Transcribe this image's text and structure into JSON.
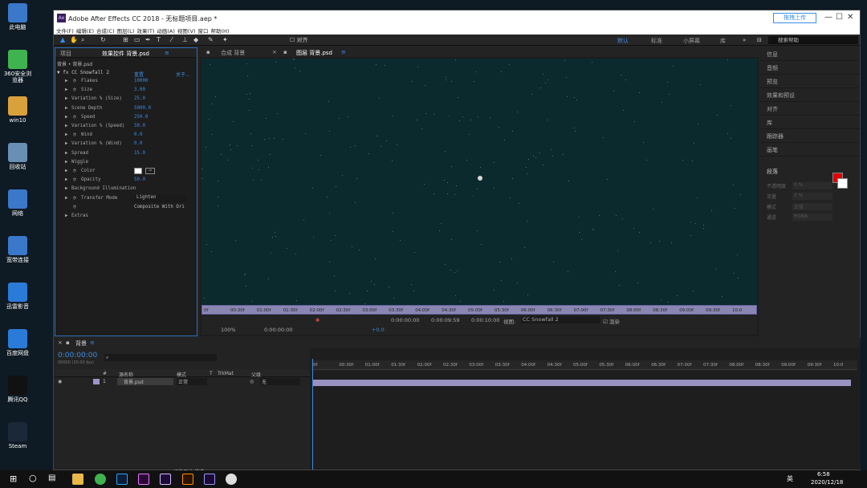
{
  "desktop": {
    "icons": [
      {
        "label": "此电脑",
        "color": "#3a78c9"
      },
      {
        "label": "360安全浏览器",
        "color": "#3fb34f"
      },
      {
        "label": "win10",
        "color": "#d9a13b"
      },
      {
        "label": "回收站",
        "color": "#6a8fb5"
      },
      {
        "label": "网络",
        "color": "#3a78c9"
      },
      {
        "label": "宽带连接",
        "color": "#3a78c9"
      },
      {
        "label": "迅雷影音",
        "color": "#2a7bd8"
      },
      {
        "label": "百度网盘",
        "color": "#2a7bd8"
      },
      {
        "label": "腾讯QQ",
        "color": "#111111"
      },
      {
        "label": "Steam",
        "color": "#1b2838"
      }
    ]
  },
  "window": {
    "title": "Adobe After Effects CC 2018 - 无标题项目.aep *",
    "app_badge": "Ae",
    "cloud_button": "拖拽上传",
    "minimize": "—",
    "maximize": "☐",
    "close": "✕"
  },
  "menu": [
    "文件(F)",
    "编辑(E)",
    "合成(C)",
    "图层(L)",
    "效果(T)",
    "动画(A)",
    "视图(V)",
    "窗口",
    "帮助(H)"
  ],
  "toolbar": {
    "align_label": "对齐",
    "workspaces": [
      "默认",
      "标准",
      "小屏幕",
      "库"
    ],
    "help_placeholder": "搜索帮助"
  },
  "fx_panel": {
    "tab_project": "项目",
    "tab_effects": "效果控件 背景.psd",
    "layer_path": "背景 • 背景.psd",
    "effect_name": "CC Snowfall 2",
    "reset": "重置",
    "about": "关于...",
    "params": [
      {
        "label": "Flakes",
        "value": "10000",
        "indent": 1,
        "stopwatch": true
      },
      {
        "label": "Size",
        "value": "3.00",
        "indent": 1,
        "stopwatch": true
      },
      {
        "label": "Variation % (Size)",
        "value": "25.0",
        "indent": 0
      },
      {
        "label": "Scene Depth",
        "value": "5000.0",
        "indent": 0
      },
      {
        "label": "Speed",
        "value": "250.0",
        "indent": 1,
        "stopwatch": true
      },
      {
        "label": "Variation % (Speed)",
        "value": "50.0",
        "indent": 0
      },
      {
        "label": "Wind",
        "value": "0.0",
        "indent": 1,
        "stopwatch": true
      },
      {
        "label": "Variation % (Wind)",
        "value": "0.0",
        "indent": 0
      },
      {
        "label": "Spread",
        "value": "15.0",
        "indent": 0
      },
      {
        "label": "Wiggle",
        "value": "",
        "indent": 0
      },
      {
        "label": "Color",
        "value": "",
        "indent": 1,
        "stopwatch": true
      },
      {
        "label": "Opacity",
        "value": "50.0",
        "indent": 1,
        "stopwatch": true
      },
      {
        "label": "Background Illumination",
        "value": "",
        "indent": 0
      },
      {
        "label": "Transfer Mode",
        "value": "Lighten",
        "indent": 1,
        "stopwatch": true
      },
      {
        "label": "",
        "value": "Composite With Ori",
        "indent": 1,
        "stopwatch": true
      },
      {
        "label": "Extras",
        "value": "",
        "indent": 0
      }
    ]
  },
  "comp": {
    "tab_comp": "合成 背景",
    "tab_layer": "图层 背景.psd",
    "ruler": [
      "0f",
      "00:30f",
      "01:00f",
      "01:30f",
      "02:00f",
      "02:30f",
      "03:00f",
      "03:30f",
      "04:00f",
      "04:30f",
      "05:00f",
      "05:30f",
      "06:00f",
      "06:30f",
      "07:00f",
      "07:30f",
      "08:00f",
      "08:30f",
      "09:00f",
      "09:30f",
      "10:0"
    ],
    "time_current": "0:00:00:00",
    "time_dur": "0:00:09:59",
    "time_end": "0:00:10:00",
    "view_label": "视图:",
    "view_value": "CC Snowfall 2",
    "render_label": "渲染",
    "zoom": "100%",
    "time_bottom": "0:00:00:00",
    "offset": "+0.0"
  },
  "right_panel": {
    "items": [
      "信息",
      "音频",
      "预览",
      "效果和预设",
      "对齐",
      "库",
      "跟踪器",
      "画笔"
    ],
    "paragraph": "段落",
    "props": [
      {
        "label": "不透明度",
        "value": "0 %"
      },
      {
        "label": "流量",
        "value": "0 %"
      },
      {
        "label": "模式",
        "value": "正常"
      },
      {
        "label": "通道",
        "value": "RGBA"
      }
    ],
    "fg_color": "#e00000",
    "bg_color": "#ffffff"
  },
  "timeline": {
    "tab": "背景",
    "timecode": "0:00:00:00",
    "timecode_sub": "00000 (30.00 fps)",
    "headers": {
      "num": "#",
      "name": "源名称",
      "mode": "模式",
      "t": "T",
      "trkmat": "TrkMat",
      "parent": "父级"
    },
    "layer": {
      "num": "1",
      "name": "背景.psd",
      "mode": "正常",
      "parent": "无"
    },
    "ruler": [
      "0f",
      "00:30f",
      "01:00f",
      "01:30f",
      "02:00f",
      "02:30f",
      "03:00f",
      "03:30f",
      "04:00f",
      "04:30f",
      "05:00f",
      "05:30f",
      "06:00f",
      "06:30f",
      "07:00f",
      "07:30f",
      "08:00f",
      "08:30f",
      "09:00f",
      "09:30f",
      "10:0"
    ],
    "toggle_label": "切换开关/模式"
  },
  "taskbar": {
    "time": "6:58",
    "date": "2020/12/18",
    "ime": "英"
  }
}
